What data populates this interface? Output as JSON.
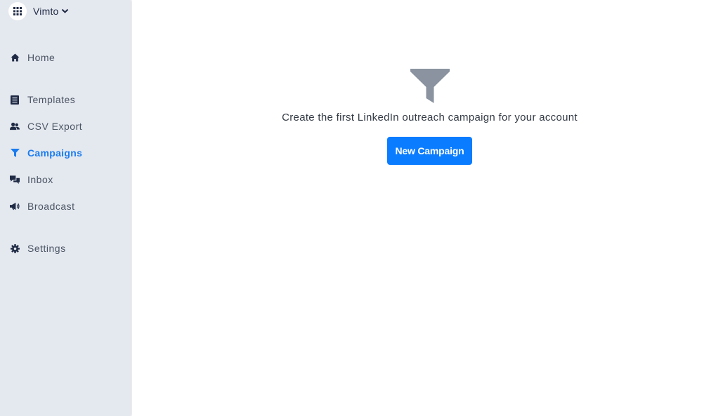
{
  "account": {
    "name": "Vimto",
    "apps_icon": "grid-icon",
    "dropdown_icon": "chevron-down-icon"
  },
  "sidebar": {
    "items": [
      {
        "label": "Home",
        "icon": "home-icon",
        "active": false
      },
      {
        "label": "Templates",
        "icon": "list-icon",
        "active": false
      },
      {
        "label": "CSV Export",
        "icon": "users-icon",
        "active": false
      },
      {
        "label": "Campaigns",
        "icon": "filter-icon",
        "active": true
      },
      {
        "label": "Inbox",
        "icon": "chat-icon",
        "active": false
      },
      {
        "label": "Broadcast",
        "icon": "megaphone-icon",
        "active": false
      },
      {
        "label": "Settings",
        "icon": "gear-icon",
        "active": false
      }
    ]
  },
  "main": {
    "empty_state_icon": "filter-icon",
    "empty_state_text": "Create the first LinkedIn outreach campaign for your account",
    "new_campaign_label": "New Campaign"
  },
  "colors": {
    "sidebar_bg": "#e4e8ef",
    "accent": "#0a7cff",
    "active_nav": "#1a7cf0",
    "empty_icon": "#8a939f"
  }
}
